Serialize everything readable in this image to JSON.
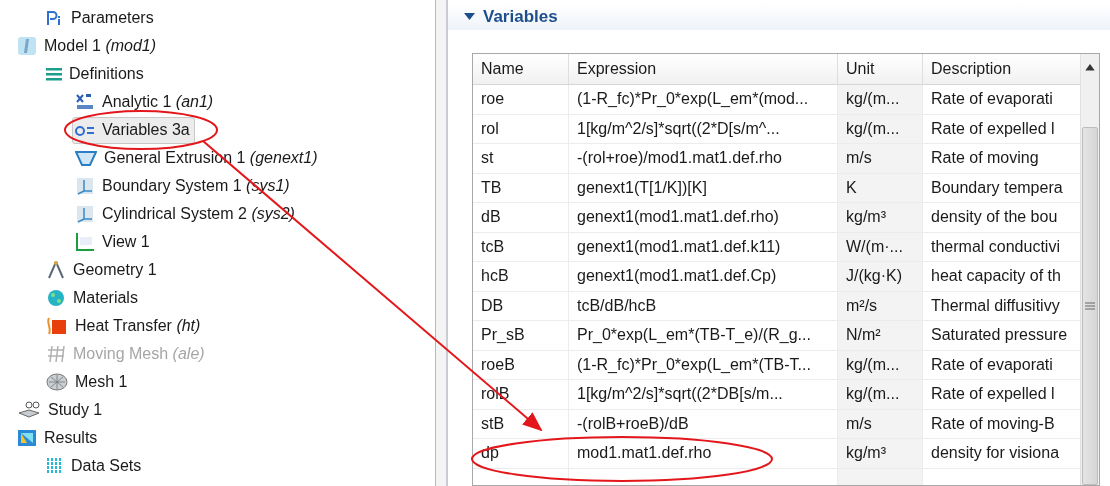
{
  "tree": {
    "items": [
      {
        "children": [
          {
            "kind": "parameters",
            "label": "Parameters",
            "selected": false,
            "disabled": false
          }
        ]
      },
      {
        "kind": "model",
        "label": "Model 1",
        "suffix": "(mod1)",
        "selected": false,
        "disabled": false,
        "children": [
          {
            "kind": "definitions",
            "label": "Definitions",
            "selected": false,
            "disabled": false,
            "children": [
              {
                "kind": "analytic",
                "label": "Analytic 1",
                "suffix": "(an1)",
                "selected": false,
                "disabled": false
              },
              {
                "kind": "variables",
                "label": "Variables 3a",
                "selected": true,
                "disabled": false
              },
              {
                "kind": "extrusion",
                "label": "General Extrusion 1",
                "suffix": "(genext1)",
                "selected": false,
                "disabled": false
              },
              {
                "kind": "system",
                "label": "Boundary System 1",
                "suffix": "(sys1)",
                "selected": false,
                "disabled": false
              },
              {
                "kind": "system",
                "label": "Cylindrical System 2",
                "suffix": "(sys2)",
                "selected": false,
                "disabled": false
              },
              {
                "kind": "view",
                "label": "View 1",
                "selected": false,
                "disabled": false
              }
            ]
          },
          {
            "kind": "geometry",
            "label": "Geometry 1",
            "selected": false,
            "disabled": false
          },
          {
            "kind": "materials",
            "label": "Materials",
            "selected": false,
            "disabled": false
          },
          {
            "kind": "heat",
            "label": "Heat Transfer",
            "suffix": "(ht)",
            "selected": false,
            "disabled": false
          },
          {
            "kind": "mesh-moving",
            "label": "Moving Mesh",
            "suffix": "(ale)",
            "selected": false,
            "disabled": true
          },
          {
            "kind": "mesh",
            "label": "Mesh 1",
            "selected": false,
            "disabled": false
          }
        ]
      },
      {
        "kind": "study",
        "label": "Study 1",
        "selected": false,
        "disabled": false
      },
      {
        "kind": "results",
        "label": "Results",
        "selected": false,
        "disabled": false,
        "children": [
          {
            "kind": "datasets",
            "label": "Data Sets",
            "selected": false,
            "disabled": false
          }
        ]
      }
    ]
  },
  "variables": {
    "title": "Variables",
    "expanded": true,
    "columns": [
      "Name",
      "Expression",
      "Unit",
      "Description"
    ],
    "rows": [
      [
        "roe",
        "(1-R_fc)*Pr_0*exp(L_em*(mod...",
        "kg/(m...",
        "Rate of evaporati"
      ],
      [
        "rol",
        "1[kg/m^2/s]*sqrt((2*D[s/m^...",
        "kg/(m...",
        "Rate of expelled l"
      ],
      [
        "st",
        "-(rol+roe)/mod1.mat1.def.rho",
        "m/s",
        "Rate of moving"
      ],
      [
        "TB",
        "genext1(T[1/K])[K]",
        "K",
        "Boundary tempera"
      ],
      [
        "dB",
        "genext1(mod1.mat1.def.rho)",
        "kg/m³",
        "density of the bou"
      ],
      [
        "tcB",
        "genext1(mod1.mat1.def.k11)",
        "W/(m·...",
        "thermal conductivi"
      ],
      [
        "hcB",
        "genext1(mod1.mat1.def.Cp)",
        "J/(kg·K)",
        "heat capacity of th"
      ],
      [
        "DB",
        "tcB/dB/hcB",
        "m²/s",
        "Thermal diffusitivy"
      ],
      [
        "Pr_sB",
        "Pr_0*exp(L_em*(TB-T_e)/(R_g...",
        "N/m²",
        "Saturated pressure"
      ],
      [
        "roeB",
        "(1-R_fc)*Pr_0*exp(L_em*(TB-T...",
        "kg/(m...",
        "Rate of evaporati"
      ],
      [
        "rolB",
        "1[kg/m^2/s]*sqrt((2*DB[s/m...",
        "kg/(m...",
        "Rate of expelled l"
      ],
      [
        "stB",
        "-(rolB+roeB)/dB",
        "m/s",
        "Rate of moving-B"
      ],
      [
        "dp",
        "mod1.mat1.def.rho",
        "kg/m³",
        "density for visiona"
      ]
    ]
  }
}
